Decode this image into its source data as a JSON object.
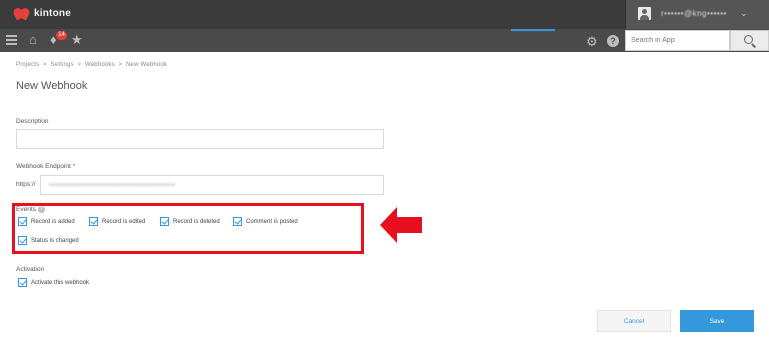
{
  "header": {
    "app_name": "kintone",
    "user_name": "r••••••@kng••••••"
  },
  "nav": {
    "notification_count": "14",
    "search_placeholder": "Search in App"
  },
  "breadcrumb": [
    "Projects",
    "Settings",
    "Webhooks",
    "New Webhook"
  ],
  "page_title": "New Webhook",
  "description": {
    "label": "Description",
    "value": ""
  },
  "endpoint": {
    "label": "Webhook Endpoint",
    "required_mark": "*",
    "prefix": "https://",
    "value": "•••••••••••••••••••••••••••••••••••••••••••••••••"
  },
  "events": {
    "label": "Events",
    "options": [
      {
        "label": "Record is added",
        "checked": true
      },
      {
        "label": "Record is edited",
        "checked": true
      },
      {
        "label": "Record is deleted",
        "checked": true
      },
      {
        "label": "Comment is posted",
        "checked": true
      },
      {
        "label": "Status is changed",
        "checked": true
      }
    ]
  },
  "activation": {
    "label": "Activation",
    "option_label": "Activate this webhook",
    "checked": true
  },
  "buttons": {
    "cancel": "Cancel",
    "save": "Save"
  },
  "colors": {
    "accent": "#3498db",
    "highlight": "#e8101e"
  }
}
